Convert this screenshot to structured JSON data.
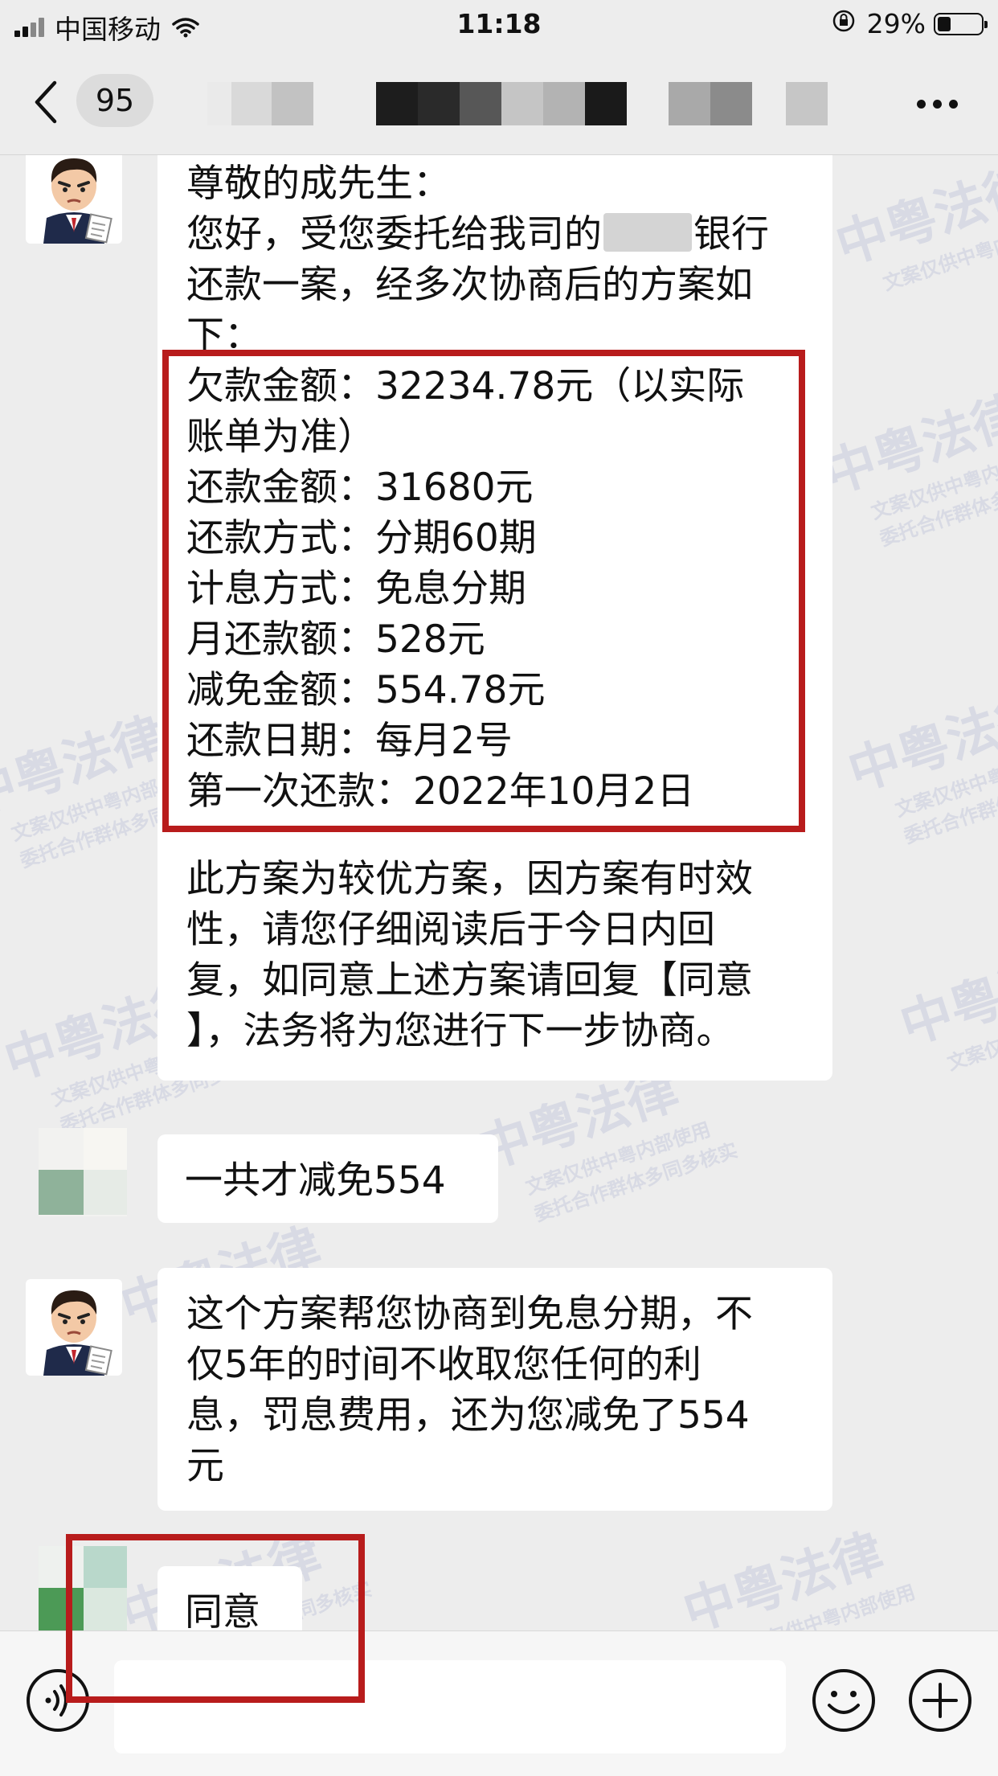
{
  "status_bar": {
    "carrier": "中国移动",
    "time": "11:18",
    "battery": "29%",
    "battery_level": 0.29
  },
  "nav": {
    "unread_count": "95"
  },
  "messages": {
    "m1": {
      "salutation": "尊敬的成先生：",
      "intro_a": "您好，受您委托给我司的",
      "intro_b": "银行",
      "intro_2": "还款一案，经多次协商后的方案如",
      "intro_3": "下：",
      "plan_lines": [
        "欠款金额：32234.78元（以实际",
        "账单为准）",
        "还款金额：31680元",
        "还款方式：分期60期",
        "计息方式：免息分期",
        "月还款额：528元",
        "减免金额：554.78元",
        "还款日期：每月2号",
        "第一次还款：2022年10月2日"
      ],
      "closing": [
        "此方案为较优方案，因方案有时效",
        "性，请您仔细阅读后于今日内回",
        "复，如同意上述方案请回复【同意",
        "】，法务将为您进行下一步协商。"
      ]
    },
    "m2": {
      "text": "一共才减免554"
    },
    "m3": {
      "lines": [
        "这个方案帮您协商到免息分期，不",
        "仅5年的时间不收取您任何的利",
        "息，罚息费用，还为您减免了554",
        "元"
      ]
    },
    "m4": {
      "text": "同意"
    }
  },
  "watermark": {
    "main": "中粤法律",
    "sub1": "文案仅供中粤内部使用",
    "sub2": "委托合作群体多同多核实"
  },
  "input": {
    "placeholder": ""
  },
  "icons": {
    "back": "chevron-left-icon",
    "more": "more-dots-icon",
    "voice": "voice-icon",
    "emoji": "emoji-icon",
    "plus": "plus-icon",
    "avatar": "lawyer-avatar"
  },
  "colors": {
    "background": "#ededed",
    "bubble": "#ffffff",
    "highlight_frame": "#b81c1c",
    "watermark": "#a0aacd"
  }
}
